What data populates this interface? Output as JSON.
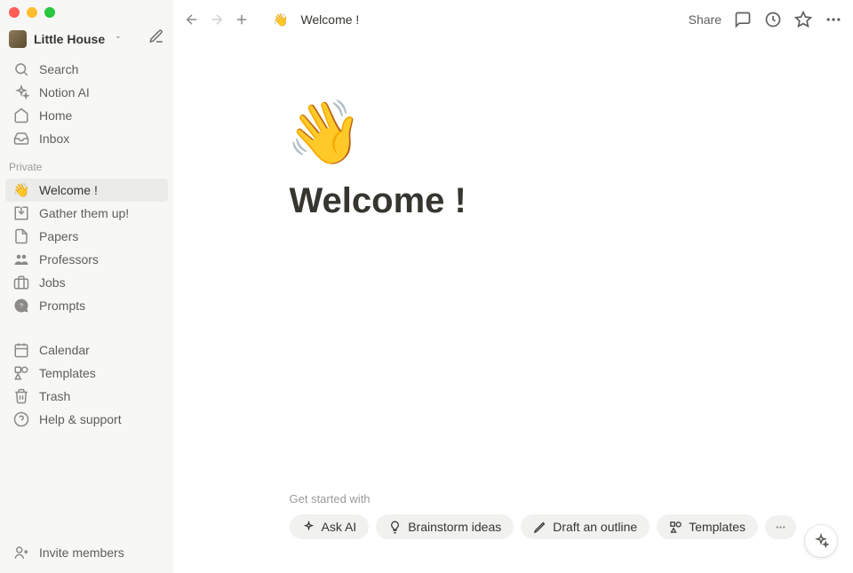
{
  "workspace": {
    "name": "Little House"
  },
  "sidebar": {
    "top": [
      {
        "label": "Search",
        "icon": "search-icon"
      },
      {
        "label": "Notion AI",
        "icon": "sparkle-icon"
      },
      {
        "label": "Home",
        "icon": "home-icon"
      },
      {
        "label": "Inbox",
        "icon": "inbox-icon"
      }
    ],
    "section_label": "Private",
    "pages": [
      {
        "label": "Welcome !",
        "emoji": "👋",
        "active": true
      },
      {
        "label": "Gather them up!",
        "icon": "import-icon"
      },
      {
        "label": "Papers",
        "icon": "page-icon"
      },
      {
        "label": "Professors",
        "icon": "people-icon"
      },
      {
        "label": "Jobs",
        "icon": "briefcase-icon"
      },
      {
        "label": "Prompts",
        "icon": "chat-icon"
      }
    ],
    "tools": [
      {
        "label": "Calendar",
        "icon": "calendar-icon"
      },
      {
        "label": "Templates",
        "icon": "shapes-icon"
      },
      {
        "label": "Trash",
        "icon": "trash-icon"
      },
      {
        "label": "Help & support",
        "icon": "help-icon"
      }
    ],
    "invite_label": "Invite members"
  },
  "topbar": {
    "breadcrumb_emoji": "👋",
    "breadcrumb_title": "Welcome !",
    "share_label": "Share"
  },
  "page": {
    "emoji": "👋",
    "title": "Welcome !"
  },
  "suggestions": {
    "label": "Get started with",
    "chips": [
      {
        "label": "Ask AI"
      },
      {
        "label": "Brainstorm ideas"
      },
      {
        "label": "Draft an outline"
      },
      {
        "label": "Templates"
      }
    ]
  }
}
